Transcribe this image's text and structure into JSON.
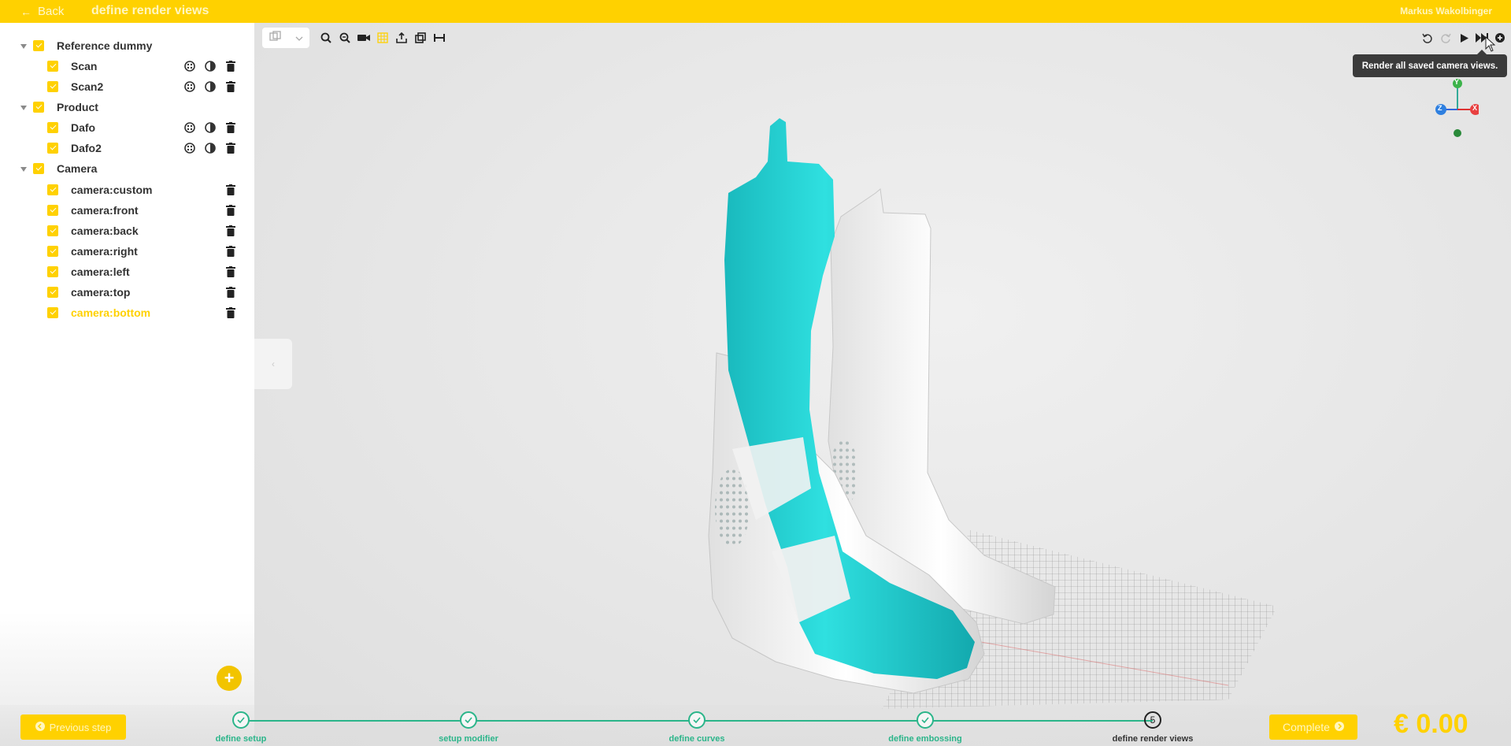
{
  "header": {
    "back_label": "Back",
    "title": "define render views",
    "user": "Markus Wakolbinger"
  },
  "tree": [
    {
      "label": "Reference dummy",
      "level": 0,
      "expanded": true
    },
    {
      "label": "Scan",
      "level": 1,
      "icons": [
        "texture-icon",
        "contrast-icon",
        "trash-icon"
      ]
    },
    {
      "label": "Scan2",
      "level": 1,
      "icons": [
        "texture-icon",
        "contrast-icon",
        "trash-icon"
      ]
    },
    {
      "label": "Product",
      "level": 0,
      "expanded": true
    },
    {
      "label": "Dafo",
      "level": 1,
      "icons": [
        "texture-icon",
        "contrast-icon",
        "trash-icon"
      ]
    },
    {
      "label": "Dafo2",
      "level": 1,
      "icons": [
        "texture-icon",
        "contrast-icon",
        "trash-icon"
      ]
    },
    {
      "label": "Camera",
      "level": 0,
      "expanded": true
    },
    {
      "label": "camera:custom",
      "level": 1,
      "icons": [
        "trash-icon"
      ]
    },
    {
      "label": "camera:front",
      "level": 1,
      "icons": [
        "trash-icon"
      ]
    },
    {
      "label": "camera:back",
      "level": 1,
      "icons": [
        "trash-icon"
      ]
    },
    {
      "label": "camera:right",
      "level": 1,
      "icons": [
        "trash-icon"
      ]
    },
    {
      "label": "camera:left",
      "level": 1,
      "icons": [
        "trash-icon"
      ]
    },
    {
      "label": "camera:top",
      "level": 1,
      "icons": [
        "trash-icon"
      ]
    },
    {
      "label": "camera:bottom",
      "level": 1,
      "icons": [
        "trash-icon"
      ],
      "active": true
    }
  ],
  "add_button": "+",
  "toolbar": {
    "left_tools": [
      "view-cube-icon",
      "zoom-in-icon",
      "zoom-out-icon",
      "camera-icon",
      "grid-icon",
      "export-icon",
      "duplicate-icon",
      "measure-icon"
    ],
    "right_tools": [
      "undo-icon",
      "redo-icon",
      "play-icon",
      "fast-forward-icon",
      "add-icon"
    ]
  },
  "tooltip": "Render all saved camera views.",
  "axes": {
    "x": "X",
    "y": "Y",
    "z": "Z"
  },
  "footer": {
    "prev_label": "Previous step",
    "complete_label": "Complete",
    "price": "€ 0.00",
    "steps": [
      {
        "label": "define setup",
        "done": true
      },
      {
        "label": "setup modifier",
        "done": true
      },
      {
        "label": "define curves",
        "done": true
      },
      {
        "label": "define embossing",
        "done": true
      },
      {
        "label": "define render views",
        "done": false,
        "number": "5"
      }
    ]
  },
  "colors": {
    "accent": "#ffd100",
    "step_done": "#2bb58a",
    "model_cyan": "#1cc6c8"
  }
}
